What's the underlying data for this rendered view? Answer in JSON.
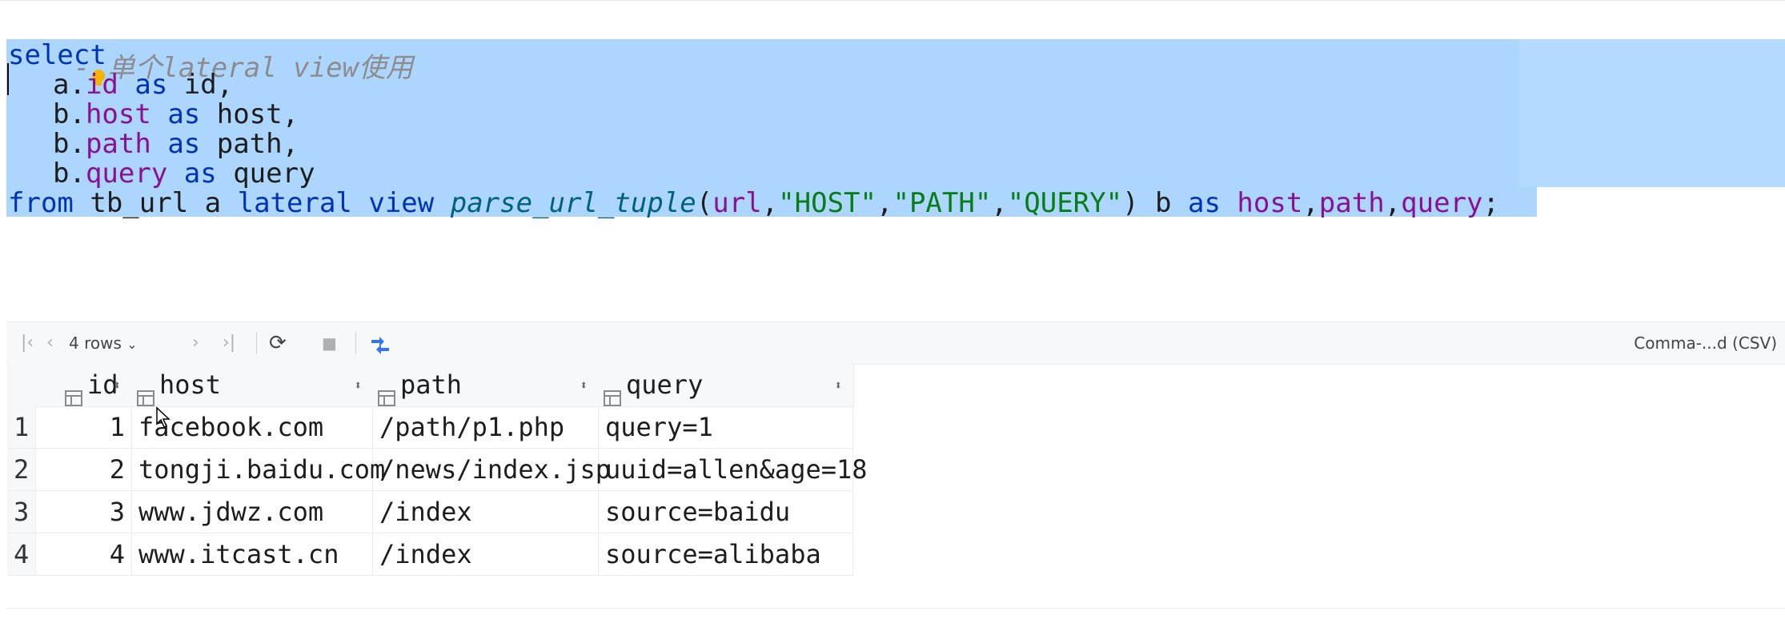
{
  "editor": {
    "comment_prefix": "-",
    "comment_text": "单个lateral view使用",
    "lines": {
      "l1": {
        "kw": "select"
      },
      "l2": {
        "a": "a.",
        "f": "id",
        "kw": " as ",
        "t": "id,"
      },
      "l3": {
        "a": "b.",
        "f": "host",
        "kw": " as ",
        "t": "host,"
      },
      "l4": {
        "a": "b.",
        "f": "path",
        "kw": " as ",
        "t": "path,"
      },
      "l5": {
        "a": "b.",
        "f": "query",
        "kw": " as ",
        "t": "query"
      },
      "l6": {
        "from": "from",
        "tbl": " tb_url a ",
        "lateral": "lateral view",
        "sp": " ",
        "fn": "parse_url_tuple",
        "lp": "(",
        "url": "url",
        "c1": ",",
        "s1": "\"HOST\"",
        "c2": ",",
        "s2": "\"PATH\"",
        "c3": ",",
        "s3": "\"QUERY\"",
        "rp": ") b ",
        "as": "as",
        "sp2": " ",
        "h": "host",
        "c4": ",",
        "p": "path",
        "c5": ",",
        "q": "query",
        "semi": ";"
      }
    }
  },
  "toolbar": {
    "first": "|‹",
    "prev": "‹",
    "rows_label": "4 rows",
    "rows_caret": "⌄",
    "next": "›",
    "last": "›|",
    "refresh": "⟳",
    "stop": "■",
    "format_label": "Comma-...d (CSV)"
  },
  "grid": {
    "columns": [
      "id",
      "host",
      "path",
      "query"
    ],
    "sort_glyph": "⬍",
    "rows": [
      {
        "n": "1",
        "id": "1",
        "host": "facebook.com",
        "path": "/path/p1.php",
        "query": "query=1"
      },
      {
        "n": "2",
        "id": "2",
        "host": "tongji.baidu.com",
        "path": "/news/index.jsp",
        "query": "uuid=allen&age=18"
      },
      {
        "n": "3",
        "id": "3",
        "host": "www.jdwz.com",
        "path": "/index",
        "query": "source=baidu"
      },
      {
        "n": "4",
        "id": "4",
        "host": "www.itcast.cn",
        "path": "/index",
        "query": "source=alibaba"
      }
    ]
  }
}
